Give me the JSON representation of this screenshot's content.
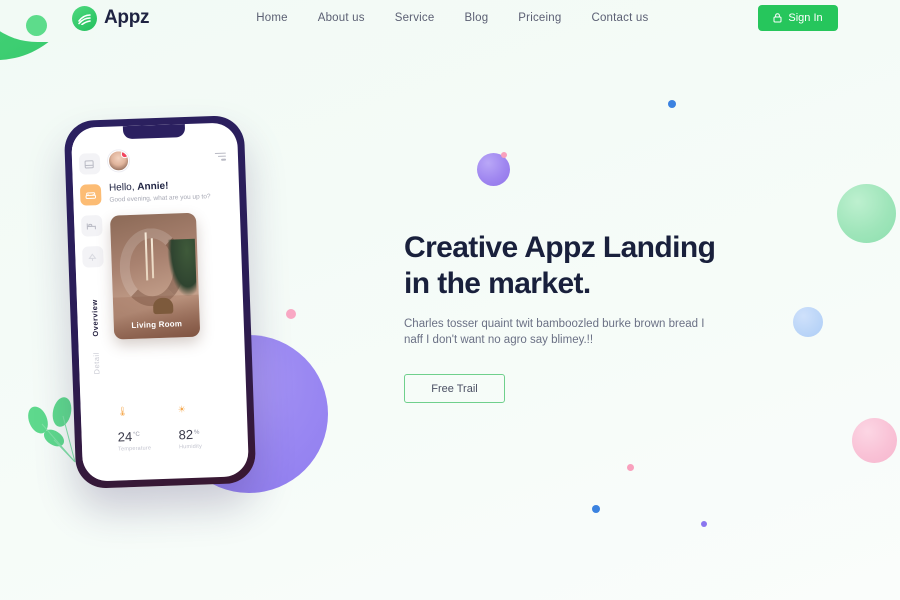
{
  "header": {
    "logo_text": "Appz",
    "nav": [
      {
        "label": "Home"
      },
      {
        "label": "About us"
      },
      {
        "label": "Service"
      },
      {
        "label": "Blog"
      },
      {
        "label": "Priceing"
      },
      {
        "label": "Contact us"
      }
    ],
    "signin_label": "Sign In"
  },
  "hero": {
    "title_line1": "Creative Appz Landing",
    "title_line2": "in the market.",
    "paragraph": "Charles tosser quaint twit bamboozled burke brown bread I naff I don't want no agro say blimey.!!",
    "cta_label": "Free Trail"
  },
  "phone": {
    "greeting_hello": "Hello, ",
    "greeting_name": "Annie!",
    "subtitle": "Good evening, what are you up to?",
    "room_card_label": "Living Room",
    "rail_labels": {
      "active": "Overview",
      "inactive": "Detail"
    },
    "stats": [
      {
        "value": "24",
        "unit": "°C",
        "label": "Temperature",
        "icon": "thermometer-icon"
      },
      {
        "value": "82",
        "unit": "%",
        "label": "Humidity",
        "icon": "humidity-icon"
      }
    ]
  },
  "colors": {
    "brand_green": "#26c65c",
    "headline_navy": "#19203c",
    "accent_orange": "#fcbc74",
    "phone_frame": "#2b2060"
  }
}
